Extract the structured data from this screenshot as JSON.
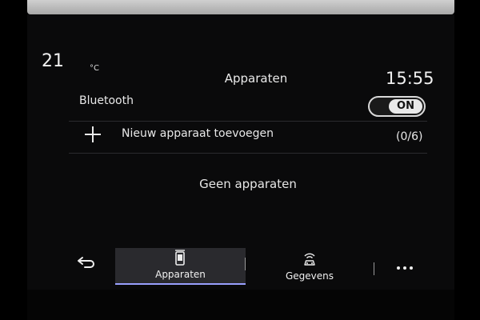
{
  "status": {
    "temperature": "21",
    "temperature_unit": "°C",
    "title": "Apparaten",
    "time": "15:55"
  },
  "bluetooth": {
    "label": "Bluetooth",
    "toggle_state": "ON"
  },
  "add_device": {
    "label": "Nieuw apparaat toevoegen",
    "count": "(0/6)"
  },
  "devices": {
    "empty_message": "Geen apparaten"
  },
  "navbar": {
    "back_icon": "back-arrow-icon",
    "tabs": [
      {
        "label": "Apparaten",
        "icon": "phone-device-icon",
        "active": true
      },
      {
        "label": "Gegevens",
        "icon": "connected-car-icon",
        "active": false
      }
    ],
    "more_icon": "more-dots-icon",
    "accent_color": "#9aa0ff"
  }
}
